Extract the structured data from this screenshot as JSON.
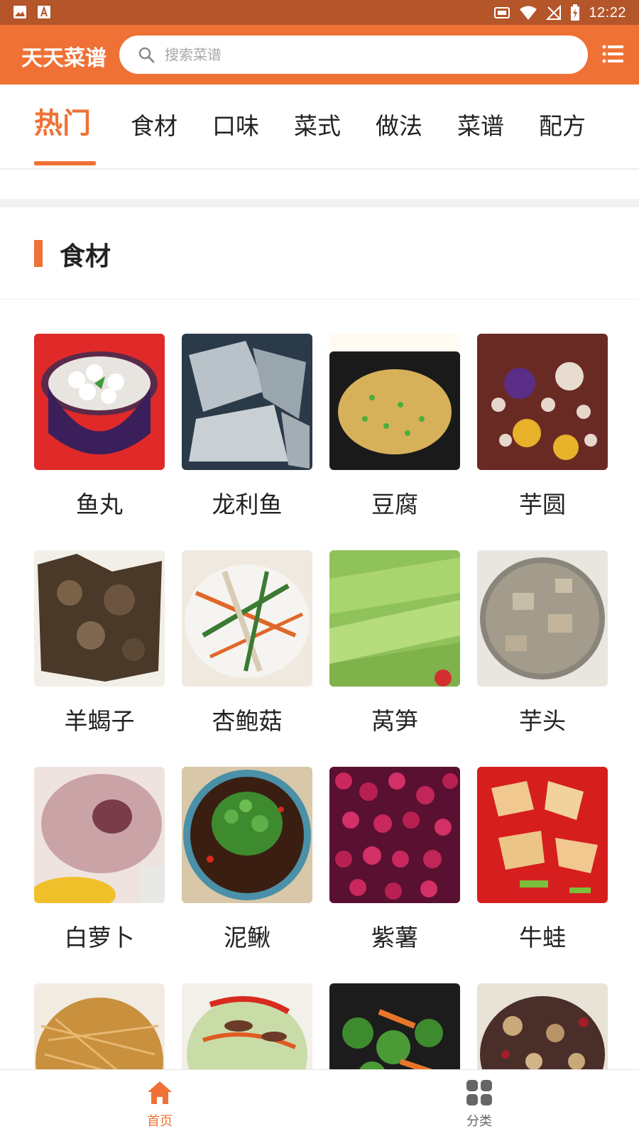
{
  "status_bar": {
    "time": "12:22",
    "icons": [
      "image-icon",
      "a-font-icon",
      "cast-icon",
      "wifi-icon",
      "no-signal-icon",
      "battery-icon"
    ]
  },
  "header": {
    "app_title": "天天菜谱",
    "search_placeholder": "搜索菜谱",
    "menu_icon": "hamburger-menu-icon",
    "accent_color": "#ef7135"
  },
  "tabs": [
    {
      "label": "热门",
      "active": true
    },
    {
      "label": "食材",
      "active": false
    },
    {
      "label": "口味",
      "active": false
    },
    {
      "label": "菜式",
      "active": false
    },
    {
      "label": "做法",
      "active": false
    },
    {
      "label": "菜谱",
      "active": false
    },
    {
      "label": "配方",
      "active": false
    }
  ],
  "section": {
    "title": "食材"
  },
  "ingredients": [
    {
      "label": "鱼丸"
    },
    {
      "label": "龙利鱼"
    },
    {
      "label": "豆腐"
    },
    {
      "label": "芋圆"
    },
    {
      "label": "羊蝎子"
    },
    {
      "label": "杏鲍菇"
    },
    {
      "label": "莴笋"
    },
    {
      "label": "芋头"
    },
    {
      "label": "白萝卜"
    },
    {
      "label": "泥鳅"
    },
    {
      "label": "紫薯"
    },
    {
      "label": "牛蛙"
    },
    {
      "label": ""
    },
    {
      "label": ""
    },
    {
      "label": ""
    },
    {
      "label": ""
    }
  ],
  "bottom_nav": [
    {
      "label": "首页",
      "icon": "home-icon",
      "active": true
    },
    {
      "label": "分类",
      "icon": "grid-icon",
      "active": false
    }
  ]
}
